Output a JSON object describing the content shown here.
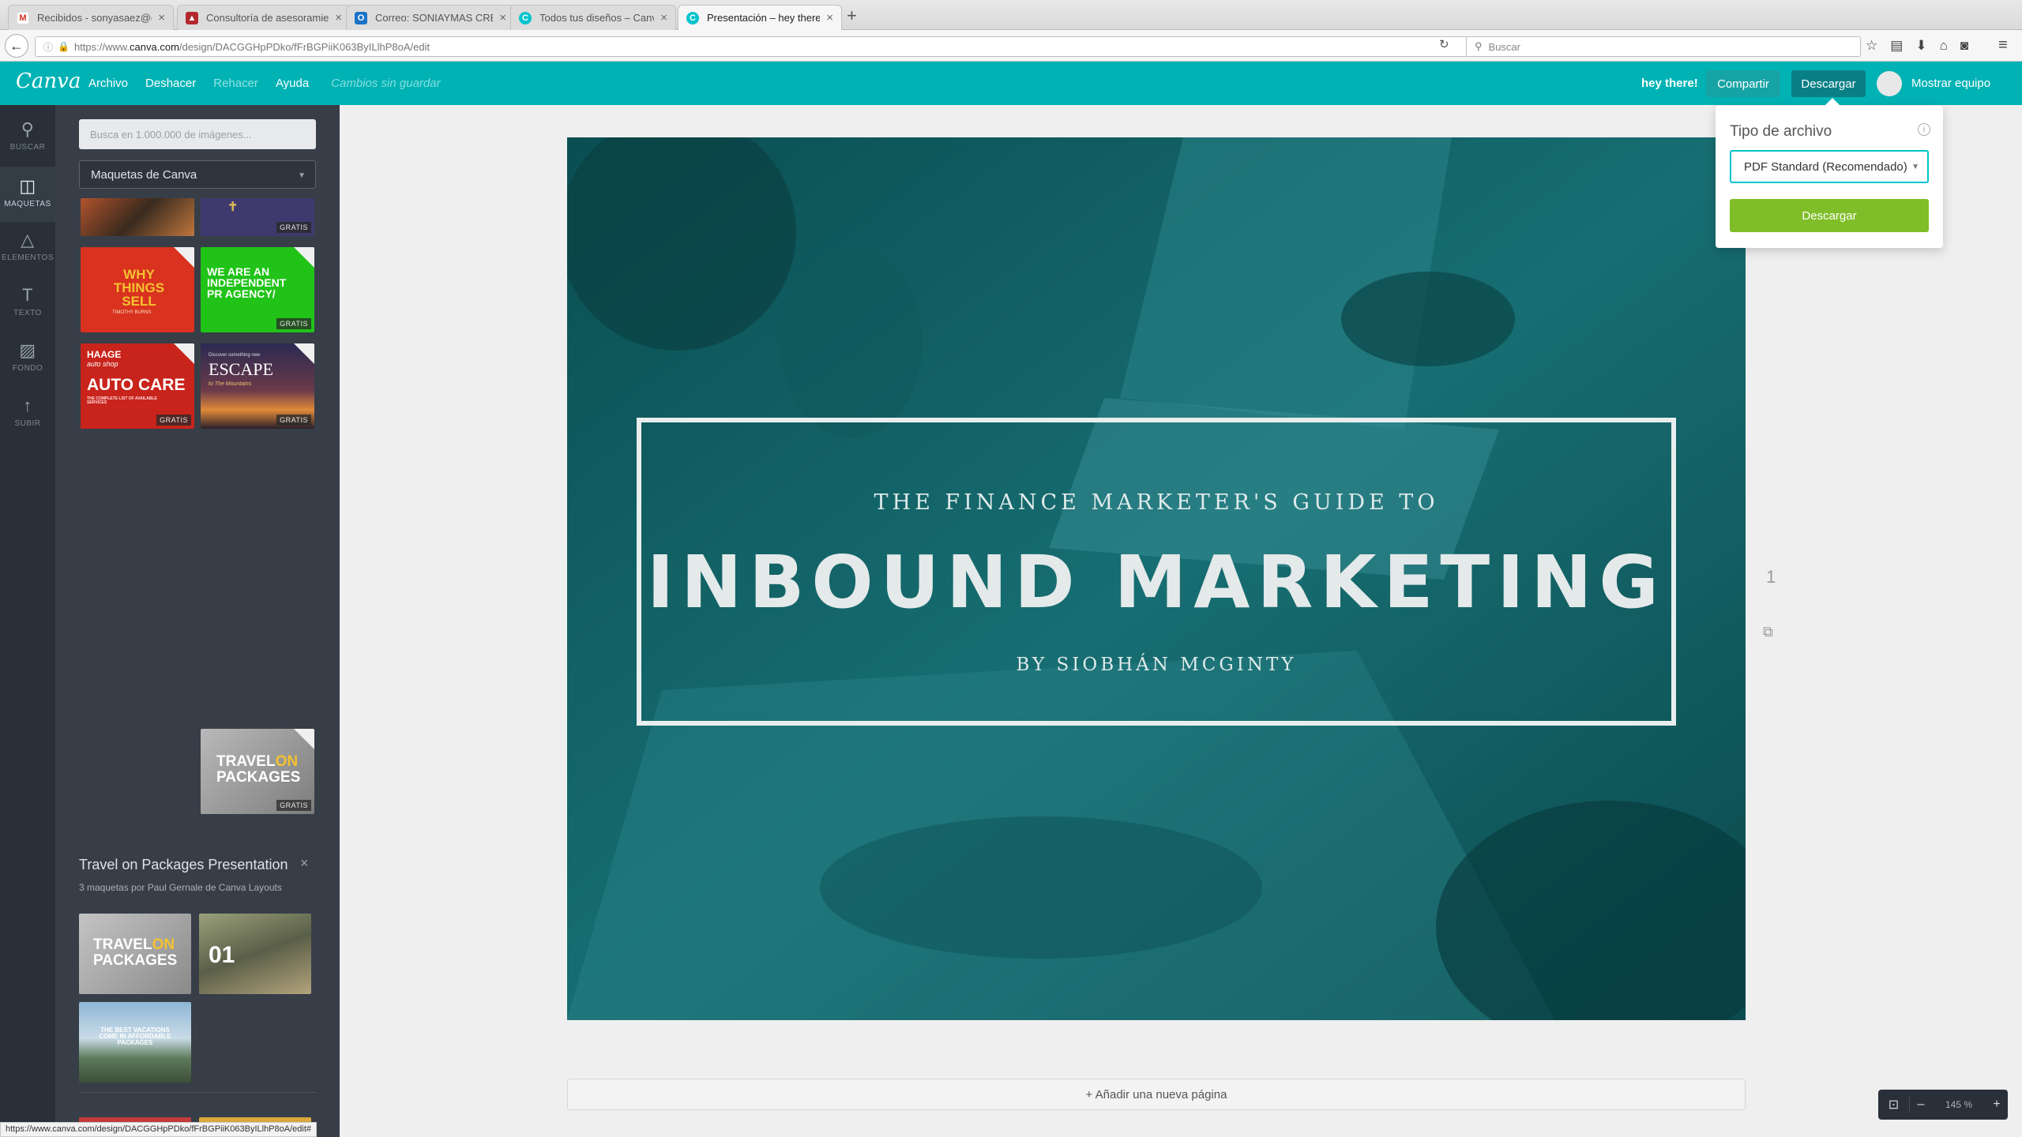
{
  "browser": {
    "tabs": [
      {
        "label": "Recibidos - sonyasaez@g...",
        "icon": "gmail-icon",
        "color": "#d93025",
        "glyph": "M"
      },
      {
        "label": "Consultoría de asesoramie...",
        "icon": "red-triangle-icon",
        "color": "#b3282d",
        "glyph": "▲"
      },
      {
        "label": "Correo: SONIAYMAS CREA...",
        "icon": "outlook-icon",
        "color": "#1b73c8",
        "glyph": "O"
      },
      {
        "label": "Todos tus diseños – Canva",
        "icon": "canva-icon",
        "color": "#00c4cc",
        "glyph": "C"
      },
      {
        "label": "Presentación – hey there!",
        "icon": "canva-icon",
        "color": "#00c4cc",
        "glyph": "C"
      }
    ],
    "url_prefix": "https://www.",
    "url_domain": "canva.com",
    "url_path": "/design/DACGGHpPDko/fFrBGPiiK063ByILlhP8oA/edit",
    "search_placeholder": "Buscar",
    "status_url": "https://www.canva.com/design/DACGGHpPDko/fFrBGPiiK063ByILlhP8oA/edit#"
  },
  "app": {
    "logo": "Canva",
    "menu": {
      "archivo": "Archivo",
      "deshacer": "Deshacer",
      "rehacer": "Rehacer",
      "ayuda": "Ayuda",
      "status": "Cambios sin guardar"
    },
    "greeting": "hey there!",
    "share_label": "Compartir",
    "download_label": "Descargar",
    "team_label": "Mostrar equipo"
  },
  "sidebar": {
    "items": [
      {
        "label": "BUSCAR",
        "icon": "search-icon"
      },
      {
        "label": "MAQUETAS",
        "icon": "layouts-icon"
      },
      {
        "label": "ELEMENTOS",
        "icon": "elements-icon"
      },
      {
        "label": "TEXTO",
        "icon": "text-icon"
      },
      {
        "label": "FONDO",
        "icon": "background-icon"
      },
      {
        "label": "SUBIR",
        "icon": "upload-icon"
      }
    ]
  },
  "panel": {
    "search_placeholder": "Busca en 1.000.000 de imágenes...",
    "select_value": "Maquetas de Canva",
    "badge": "GRATIS",
    "thumbs": {
      "why": "WHY THINGS SELL",
      "why_sub": "TIMOTHY BURNS",
      "agency": "WE ARE AN INDEPENDENT PR AGENCY/",
      "auto_top": "HAAGE",
      "auto_script": "auto shop",
      "auto_main": "AUTO CARE",
      "auto_sub": "THE COMPLETE LIST OF AVAILABLE SERVICES",
      "escape_small": "Discover something new",
      "escape": "ESCAPE",
      "escape_sub": "to The Mountains",
      "travel_a": "TRAVEL",
      "travel_b": "ON",
      "travel_c": "PACKAGES",
      "num": "01",
      "vacation": "THE BEST VACATIONS COME IN AFFORDABLE PACKAGES"
    },
    "collection_title": "Travel on Packages Presentation",
    "collection_sub": "3 maquetas por Paul Gernale de Canva Layouts"
  },
  "slide": {
    "kicker": "THE FINANCE MARKETER'S GUIDE TO",
    "headline": "INBOUND MARKETING",
    "byline": "BY SIOBHÁN MCGINTY",
    "page_number": "1",
    "add_page": "+ Añadir una nueva página"
  },
  "download_popover": {
    "title": "Tipo de archivo",
    "file_type": "PDF Standard (Recomendado)",
    "button": "Descargar"
  },
  "zoom": {
    "value": "145 %",
    "minus": "–",
    "plus": "+"
  },
  "colors": {
    "brand": "#00b2b4",
    "download_btn": "#7fbe28",
    "slide_teal": "#0d5a5e"
  }
}
